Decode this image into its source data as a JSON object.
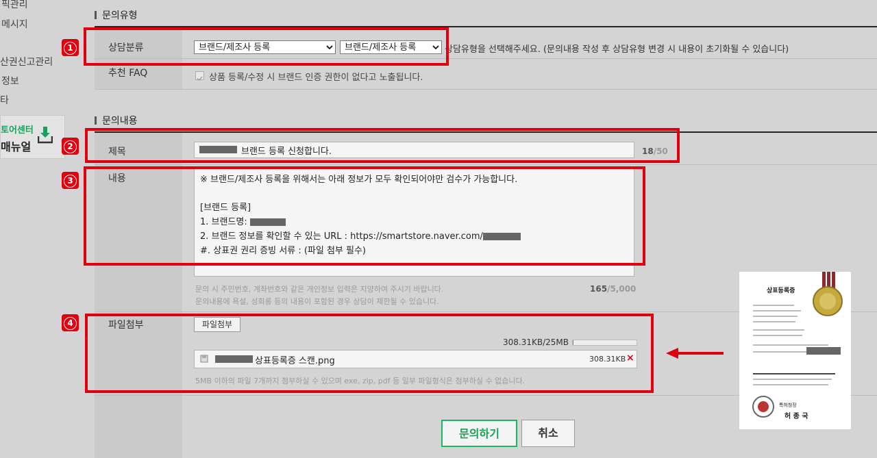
{
  "sidebar": {
    "items": [
      "픽관리",
      "메시지",
      "산권신고관리",
      "정보",
      "타"
    ],
    "store_center": "토어센터",
    "manual": "매뉴얼"
  },
  "sections": {
    "inquiry_type": "문의유형",
    "inquiry_content": "문의내용"
  },
  "inquiry_type": {
    "category_label": "상담분류",
    "select1": "브랜드/제조사 등록",
    "select2": "브랜드/제조사 등록",
    "hint": "상담유형을 선택해주세요. (문의내용 작성 후 상담유형 변경 시 내용이 초기화될 수 있습니다)",
    "faq_label": "추천 FAQ",
    "faq_item": "상품 등록/수정 시 브랜드 인증 권한이 없다고 노출됩니다."
  },
  "title_field": {
    "label": "제목",
    "value": "브랜드 등록 신청합니다.",
    "count": "18",
    "max": "/50"
  },
  "content_field": {
    "label": "내용",
    "line1": "※ 브랜드/제조사 등록을 위해서는 아래 정보가 모두 확인되어야만 검수가 가능합니다.",
    "line2": "[브랜드 등록]",
    "line3": "1. 브랜드명:",
    "line4": "2. 브랜드 정보를 확인할 수 있는 URL : https://smartstore.naver.com/",
    "line5": "#. 상표권 권리 증빙 서류 : (파일 첨부 필수)",
    "note1": "문의 시 주민번호, 계좌번호와 같은 개인정보 입력은 지양하여 주시기 바랍니다.",
    "note2": "문의내용에 욕설, 성희롱 등의 내용이 포함된 경우 상담이 제한될 수 있습니다.",
    "count": "165",
    "max": "/5,000"
  },
  "attachment": {
    "label": "파일첨부",
    "button": "파일첨부",
    "usage": "308.31KB/25MB",
    "usage_fraction": 0.012,
    "file_name": "상표등록증 스캔.png",
    "file_size": "308.31KB",
    "remove": "×",
    "note": "5MB 이하의 파일 7개까지 첨부하실 수 있으며 exe, zip, pdf 등 일부 파일형식은 첨부하실 수 없습니다."
  },
  "buttons": {
    "submit": "문의하기",
    "cancel": "취소"
  },
  "badges": [
    "1",
    "2",
    "3",
    "4"
  ],
  "certificate": {
    "title": "상표등록증",
    "issuer": "특허청장",
    "signature": "허 종 국"
  },
  "colors": {
    "highlight_red": "#e0000f",
    "brand_green": "#1fb462"
  }
}
